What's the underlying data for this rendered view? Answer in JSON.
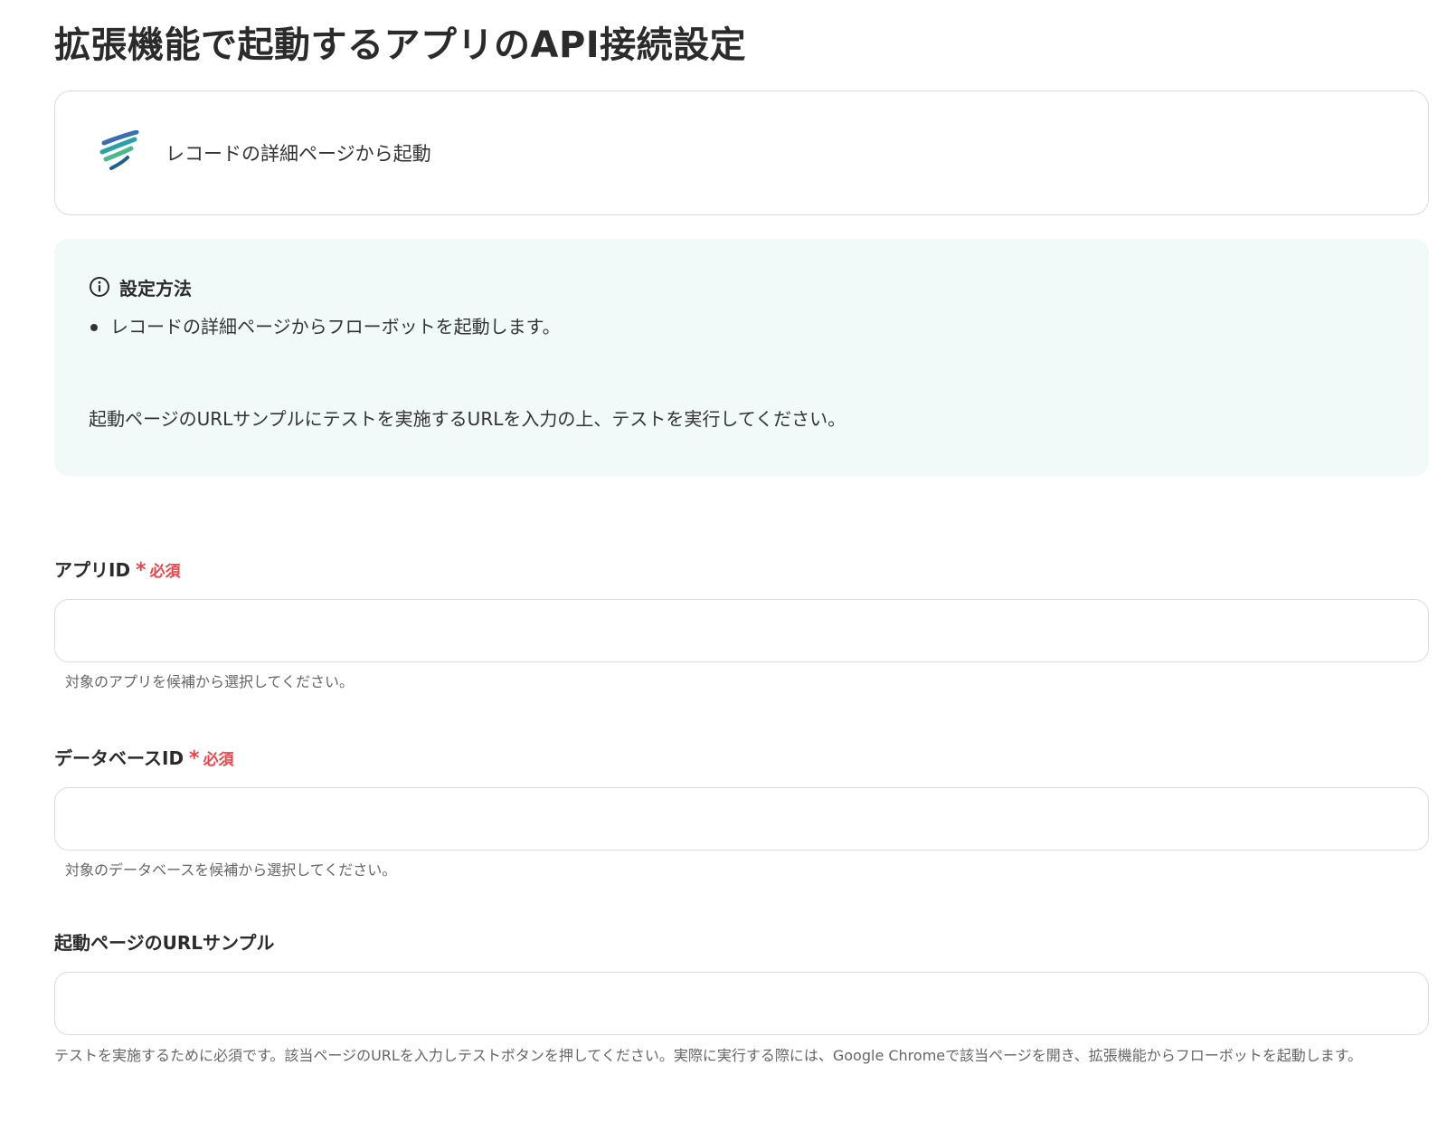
{
  "page": {
    "title": "拡張機能で起動するアプリのAPI接続設定"
  },
  "trigger": {
    "label": "レコードの詳細ページから起動",
    "icon": "kintone-logo-icon"
  },
  "info": {
    "heading": "設定方法",
    "items": [
      "レコードの詳細ページからフローボットを起動します。"
    ],
    "note": "起動ページのURLサンプルにテストを実施するURLを入力の上、テストを実行してください。"
  },
  "fields": {
    "app_id": {
      "label": "アプリID",
      "required_mark": "*",
      "required_text": "必須",
      "value": "",
      "hint": "対象のアプリを候補から選択してください。"
    },
    "database_id": {
      "label": "データベースID",
      "required_mark": "*",
      "required_text": "必須",
      "value": "",
      "hint": "対象のデータベースを候補から選択してください。"
    },
    "url_sample": {
      "label": "起動ページのURLサンプル",
      "value": "",
      "hint": "テストを実施するために必須です。該当ページのURLを入力しテストボタンを押してください。実際に実行する際には、Google Chromeで該当ページを開き、拡張機能からフローボットを起動します。"
    }
  },
  "colors": {
    "required": "#e8454b",
    "info_bg": "#f2faf9",
    "border": "#dcdcdc"
  }
}
